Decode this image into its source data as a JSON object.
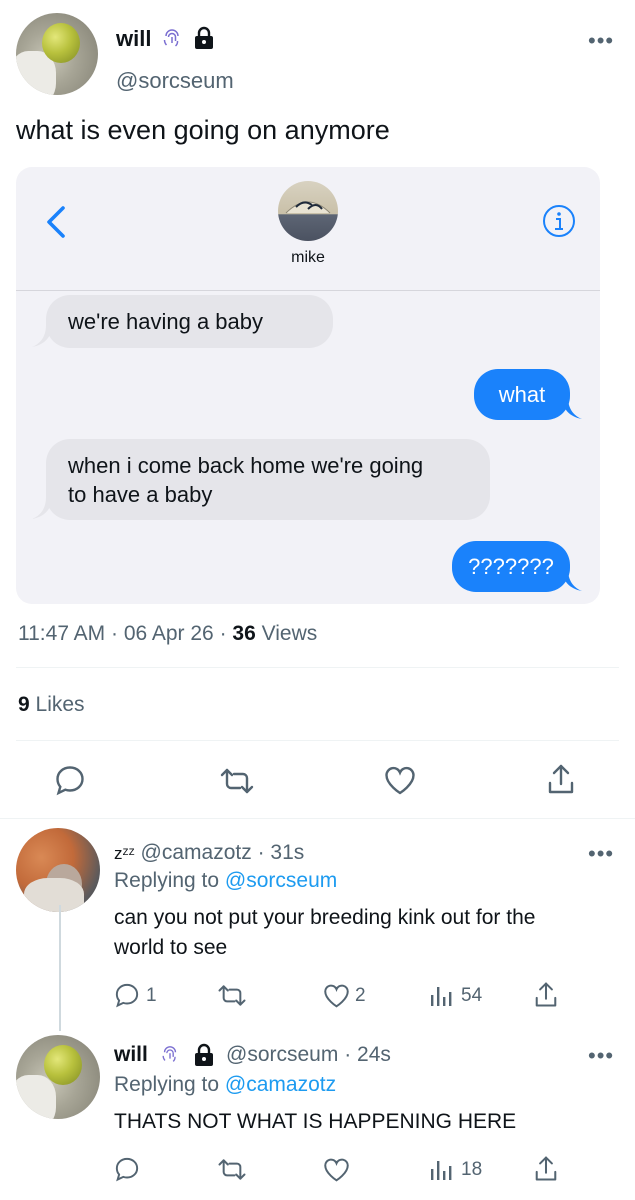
{
  "main_tweet": {
    "name": "will",
    "handle": "@sorcseum",
    "text": "what is even going on anymore",
    "time": "11:47 AM · 06 Apr 26",
    "views_count": "36",
    "views_label": "Views",
    "likes_count": "9",
    "likes_label": "Likes"
  },
  "embedded_image": {
    "contact_name": "mike",
    "messages": [
      {
        "dir": "in",
        "text_lines": [
          "we're having a baby"
        ]
      },
      {
        "dir": "out",
        "text_lines": [
          "what"
        ]
      },
      {
        "dir": "in",
        "text_lines": [
          "when i come back home we're going",
          "to have a baby"
        ]
      },
      {
        "dir": "out",
        "text_lines": [
          "???????"
        ]
      }
    ]
  },
  "replies": [
    {
      "emoji": "zᶻᶻ",
      "handle": "@camazotz",
      "time": "· 31s",
      "replying_prefix": "Replying to",
      "replying_to": "@sorcseum",
      "text_lines": [
        "can you not put your breeding kink out for the",
        "world to see"
      ],
      "reply_count": "1",
      "like_count": "2",
      "view_count": "54"
    },
    {
      "name": "will",
      "handle": "@sorcseum",
      "time": "· 24s",
      "replying_prefix": "Replying to",
      "replying_to": "@camazotz",
      "text_lines": [
        "THATS NOT WHAT IS HAPPENING HERE"
      ],
      "view_count": "18"
    }
  ],
  "icons": [
    "fingerprint-icon",
    "lock-icon",
    "more-icon",
    "back-chevron-icon",
    "info-icon",
    "reply-icon",
    "retweet-icon",
    "like-icon",
    "share-icon",
    "views-icon"
  ],
  "colors": {
    "accent": "#1d9bf0",
    "imessage_blue": "#1a82fb",
    "bubble_gray": "#e5e5ea",
    "text_secondary": "#536471"
  }
}
